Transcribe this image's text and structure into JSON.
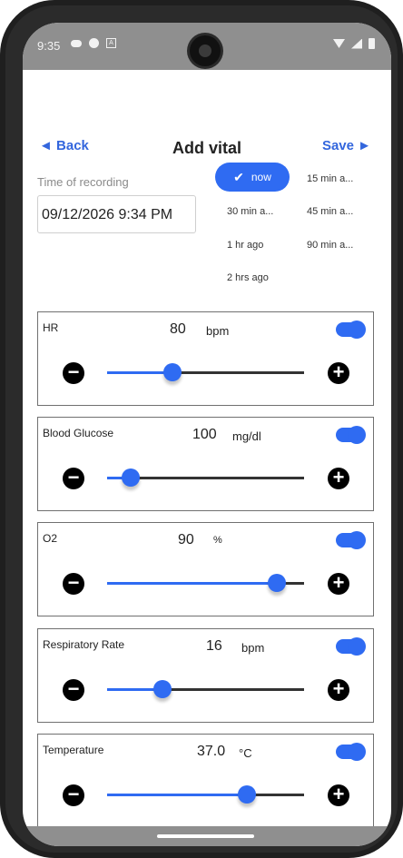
{
  "statusbar": {
    "time": "9:35",
    "icons_left": [
      "cloud-icon",
      "dot-icon",
      "notification-icon"
    ],
    "icons_right": [
      "wifi-icon",
      "signal-icon",
      "battery-icon"
    ]
  },
  "header": {
    "back_label": "◄ Back",
    "title": "Add vital",
    "save_label": "Save ►"
  },
  "recording": {
    "label": "Time of recording",
    "value": "09/12/2026 9:34 PM",
    "chips": [
      {
        "label": "now",
        "selected": true
      },
      {
        "label": "15 min a..."
      },
      {
        "label": "30 min a..."
      },
      {
        "label": "45 min a..."
      },
      {
        "label": "1 hr ago"
      },
      {
        "label": "90 min a..."
      },
      {
        "label": "2 hrs ago"
      }
    ]
  },
  "vitals": [
    {
      "name": "HR",
      "value": "80",
      "unit": "bpm",
      "slider_fraction": 0.33,
      "enabled": true
    },
    {
      "name": "Blood Glucose",
      "value": "100",
      "unit": "mg/dl",
      "slider_fraction": 0.12,
      "enabled": true
    },
    {
      "name": "O2",
      "value": "90",
      "unit": "%",
      "slider_fraction": 0.86,
      "enabled": true
    },
    {
      "name": "Respiratory Rate",
      "value": "16",
      "unit": "bpm",
      "slider_fraction": 0.28,
      "enabled": true
    },
    {
      "name": "Temperature",
      "value": "37.0",
      "unit": "°C",
      "slider_fraction": 0.71,
      "enabled": true
    }
  ],
  "colors": {
    "accent": "#2f6bf2",
    "link": "#3366dd",
    "border": "#707070",
    "track": "#333333"
  }
}
